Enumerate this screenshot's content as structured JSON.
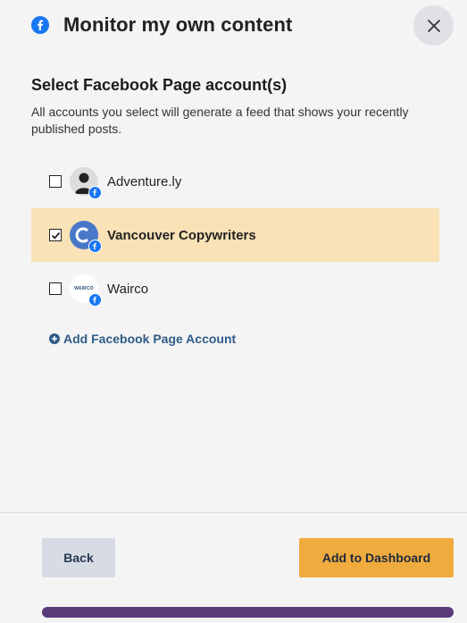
{
  "header": {
    "title": "Monitor my own content",
    "close_icon": "close-icon",
    "platform_icon": "facebook-icon"
  },
  "section": {
    "title": "Select Facebook Page account(s)",
    "description": "All accounts you select will generate a feed that shows your recently published posts."
  },
  "accounts": [
    {
      "name": "Adventure.ly",
      "checked": false,
      "avatar": "person-avatar"
    },
    {
      "name": "Vancouver Copywriters",
      "checked": true,
      "avatar": "c-logo-avatar"
    },
    {
      "name": "Wairco",
      "checked": false,
      "avatar": "wairco-logo-avatar",
      "avatar_text": "WAIRCO"
    }
  ],
  "add_account_label": "Add Facebook Page Account",
  "footer": {
    "back_label": "Back",
    "add_label": "Add to Dashboard"
  },
  "colors": {
    "accent": "#f0ab3f",
    "selected_row": "#f9e2b6",
    "facebook": "#1877f2",
    "link": "#2f5b87",
    "bottom_bar": "#5a3b7a"
  }
}
